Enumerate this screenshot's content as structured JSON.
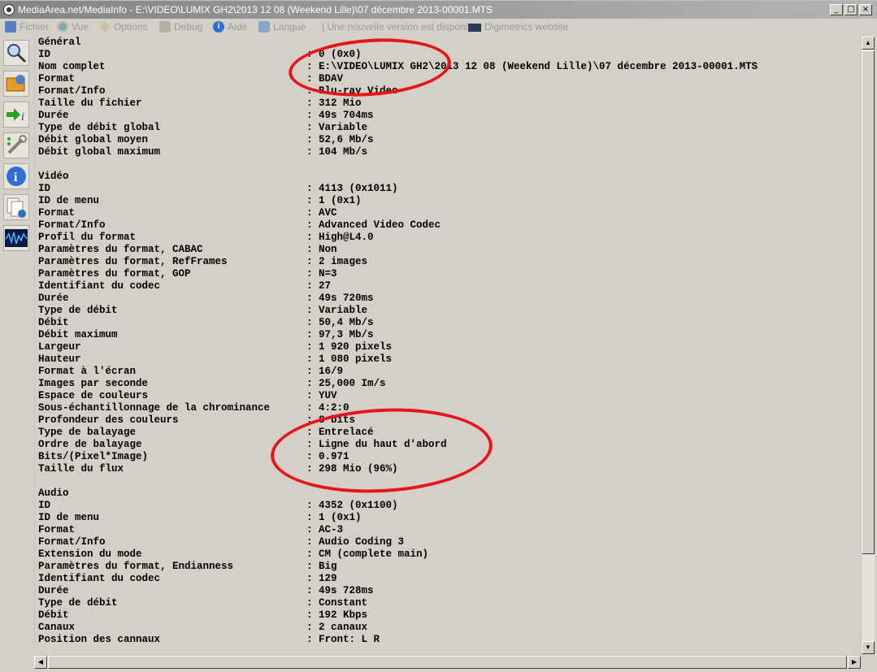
{
  "window": {
    "title": "MediaArea.net/MediaInfo - E:\\VIDEO\\LUMIX GH2\\2013 12 08 (Weekend Lille)\\07 décembre 2013-00001.MTS"
  },
  "menu": {
    "fichier": "Fichier",
    "vue": "Vue",
    "options": "Options",
    "debug": "Debug",
    "aide": "Aide",
    "langue": "Langue",
    "update": "| Une nouvelle version est disponible",
    "digimetrics": "Digimetrics website"
  },
  "report": [
    {
      "k": "Général",
      "v": ""
    },
    {
      "k": "ID",
      "v": ": 0 (0x0)"
    },
    {
      "k": "Nom complet",
      "v": ": E:\\VIDEO\\LUMIX GH2\\2013 12 08 (Weekend Lille)\\07 décembre 2013-00001.MTS"
    },
    {
      "k": "Format",
      "v": ": BDAV"
    },
    {
      "k": "Format/Info",
      "v": ": Blu-ray Video"
    },
    {
      "k": "Taille du fichier",
      "v": ": 312 Mio"
    },
    {
      "k": "Durée",
      "v": ": 49s 704ms"
    },
    {
      "k": "Type de débit global",
      "v": ": Variable"
    },
    {
      "k": "Débit global moyen",
      "v": ": 52,6 Mb/s"
    },
    {
      "k": "Débit global maximum",
      "v": ": 104 Mb/s"
    },
    {
      "k": "",
      "v": ""
    },
    {
      "k": "Vidéo",
      "v": ""
    },
    {
      "k": "ID",
      "v": ": 4113 (0x1011)"
    },
    {
      "k": "ID de menu",
      "v": ": 1 (0x1)"
    },
    {
      "k": "Format",
      "v": ": AVC"
    },
    {
      "k": "Format/Info",
      "v": ": Advanced Video Codec"
    },
    {
      "k": "Profil du format",
      "v": ": High@L4.0"
    },
    {
      "k": "Paramètres du format, CABAC",
      "v": ": Non"
    },
    {
      "k": "Paramètres du format, RefFrames",
      "v": ": 2 images"
    },
    {
      "k": "Paramètres du format, GOP",
      "v": ": N=3"
    },
    {
      "k": "Identifiant du codec",
      "v": ": 27"
    },
    {
      "k": "Durée",
      "v": ": 49s 720ms"
    },
    {
      "k": "Type de débit",
      "v": ": Variable"
    },
    {
      "k": "Débit",
      "v": ": 50,4 Mb/s"
    },
    {
      "k": "Débit maximum",
      "v": ": 97,3 Mb/s"
    },
    {
      "k": "Largeur",
      "v": ": 1 920 pixels"
    },
    {
      "k": "Hauteur",
      "v": ": 1 080 pixels"
    },
    {
      "k": "Format à l'écran",
      "v": ": 16/9"
    },
    {
      "k": "Images par seconde",
      "v": ": 25,000 Im/s"
    },
    {
      "k": "Espace de couleurs",
      "v": ": YUV"
    },
    {
      "k": "Sous-échantillonnage de la chrominance",
      "v": ": 4:2:0"
    },
    {
      "k": "Profondeur des couleurs",
      "v": ": 8 bits"
    },
    {
      "k": "Type de balayage",
      "v": ": Entrelacé"
    },
    {
      "k": "Ordre de balayage",
      "v": ": Ligne du haut d'abord"
    },
    {
      "k": "Bits/(Pixel*Image)",
      "v": ": 0.971"
    },
    {
      "k": "Taille du flux",
      "v": ": 298 Mio (96%)"
    },
    {
      "k": "",
      "v": ""
    },
    {
      "k": "Audio",
      "v": ""
    },
    {
      "k": "ID",
      "v": ": 4352 (0x1100)"
    },
    {
      "k": "ID de menu",
      "v": ": 1 (0x1)"
    },
    {
      "k": "Format",
      "v": ": AC-3"
    },
    {
      "k": "Format/Info",
      "v": ": Audio Coding 3"
    },
    {
      "k": "Extension du mode",
      "v": ": CM (complete main)"
    },
    {
      "k": "Paramètres du format, Endianness",
      "v": ": Big"
    },
    {
      "k": "Identifiant du codec",
      "v": ": 129"
    },
    {
      "k": "Durée",
      "v": ": 49s 728ms"
    },
    {
      "k": "Type de débit",
      "v": ": Constant"
    },
    {
      "k": "Débit",
      "v": ": 192 Kbps"
    },
    {
      "k": "Canaux",
      "v": ": 2 canaux"
    },
    {
      "k": "Position des cannaux",
      "v": ": Front: L R"
    }
  ],
  "colors": {
    "annotation": "#e5151a",
    "background": "#d4d0c8"
  }
}
